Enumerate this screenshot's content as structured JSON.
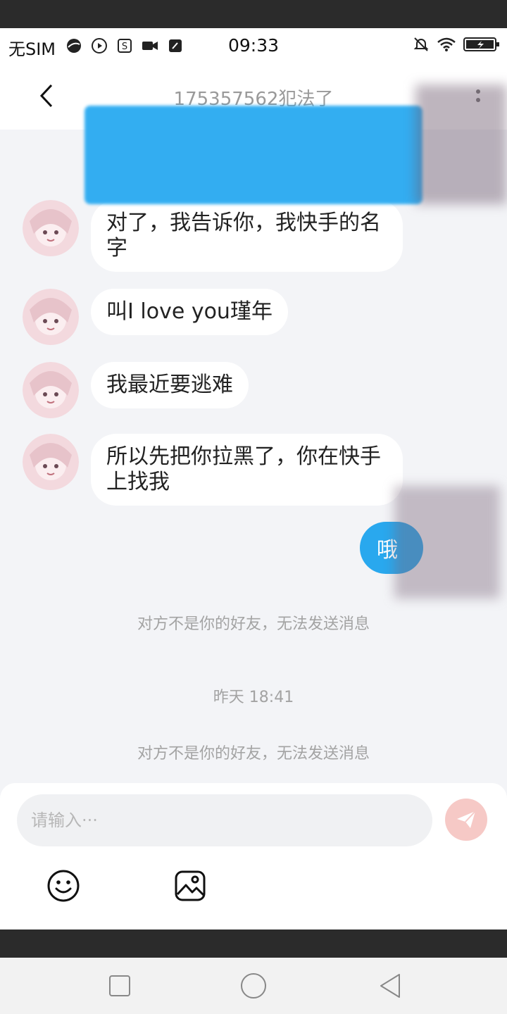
{
  "status_bar": {
    "carrier": "无SIM",
    "time": "09:33"
  },
  "header": {
    "title": "175357562犯法了"
  },
  "messages": [
    {
      "text": "对了，我告诉你，我快手的名字"
    },
    {
      "text": "叫I love you瑾年"
    },
    {
      "text": "我最近要逃难"
    },
    {
      "text": "所以先把你拉黑了，你在快手上找我"
    }
  ],
  "sent_message": {
    "text": "哦"
  },
  "system": {
    "notice_1": "对方不是你的好友，无法发送消息",
    "timestamp": "昨天 18:41",
    "notice_2": "对方不是你的好友，无法发送消息"
  },
  "input": {
    "placeholder": "请输入···"
  },
  "colors": {
    "accent": "#29a8ee",
    "send_button": "#f6c9c6",
    "background": "#f3f4f7"
  },
  "icons": [
    "back-arrow-icon",
    "more-dots-icon",
    "send-icon",
    "emoji-icon",
    "image-icon",
    "wifi-icon",
    "battery-icon",
    "mute-icon"
  ]
}
